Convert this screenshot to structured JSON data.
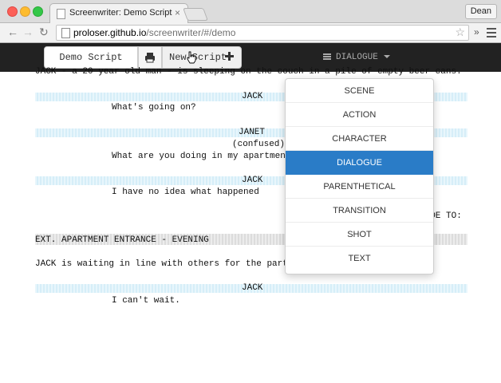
{
  "browser": {
    "tab_title": "Screenwriter: Demo Script",
    "tab_close": "×",
    "user": "Dean",
    "url_host": "proloser.github.io",
    "url_path": "/screenwriter/#/demo",
    "back": "←",
    "forward": "→",
    "reload": "↻",
    "star": "☆",
    "extensions": "»"
  },
  "toolbar": {
    "script_title": "Demo Script",
    "new_script_label": "New Script",
    "element_type": "DIALOGUE",
    "icons": [
      "print-icon",
      "plus-icon",
      "list-icon",
      "caret-down-icon"
    ]
  },
  "script": {
    "lines": [
      {
        "type": "action",
        "text": "JACK - a 20 year old man - is sleeping on the couch in a pile of empty beer cans."
      },
      {
        "type": "character",
        "text": "JACK"
      },
      {
        "type": "dialogue",
        "text": "What's going on?"
      },
      {
        "type": "character",
        "text": "JANET"
      },
      {
        "type": "parenthetical",
        "text": "(confused)"
      },
      {
        "type": "dialogue",
        "text": "What are you doing in my apartment"
      },
      {
        "type": "character",
        "text": "JACK"
      },
      {
        "type": "dialogue",
        "text": "I have no idea what happened"
      },
      {
        "type": "transition",
        "text": "FADE TO:"
      },
      {
        "type": "scene",
        "text": "EXT. APARTMENT ENTRANCE - EVENING"
      },
      {
        "type": "action",
        "text": "JACK is waiting in line with others for the party"
      },
      {
        "type": "character",
        "text": "JACK"
      },
      {
        "type": "dialogue",
        "text": "I can't wait."
      }
    ]
  },
  "dropdown": {
    "selected": "DIALOGUE",
    "items": [
      "SCENE",
      "ACTION",
      "CHARACTER",
      "DIALOGUE",
      "PARENTHETICAL",
      "TRANSITION",
      "SHOT",
      "TEXT"
    ]
  },
  "colors": {
    "toolbar_bg": "#222222",
    "active_item": "#2a7cc7",
    "character_band": "#dff2fb",
    "scene_band": "#e5e5e5"
  }
}
